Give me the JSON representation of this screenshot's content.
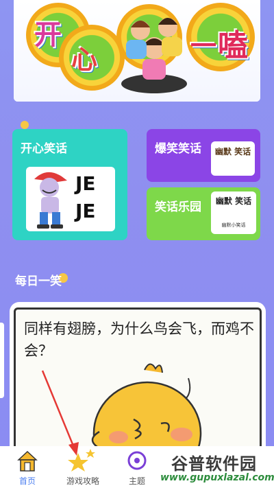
{
  "banner": {
    "title_chars": [
      "开",
      "心",
      "一",
      "嗑"
    ],
    "caption_left": "",
    "caption_right": ""
  },
  "cards": {
    "happy": {
      "title": "开心笑话",
      "img_text1": "JE",
      "img_text2": "JE",
      "color": "#2ed3c4"
    },
    "burst": {
      "title": "爆笑笑话",
      "img_text": "幽默 笑话",
      "color": "#8b45e6"
    },
    "paradise": {
      "title": "笑话乐园",
      "img_text": "幽默 笑话",
      "img_sub": "幽默小笑话",
      "color": "#7ed84a"
    }
  },
  "daily": {
    "section_title": "每日一笑",
    "joke": "同样有翅膀，为什么鸟会飞，而鸡不会？"
  },
  "tabbar": {
    "tabs": [
      {
        "label": "首页",
        "active": true
      },
      {
        "label": "游戏攻略",
        "active": false
      },
      {
        "label": "主题",
        "active": false
      }
    ]
  },
  "watermark": {
    "title": "谷普软件园",
    "url": "www.gupuxlazal.com"
  },
  "colors": {
    "background": "#8e95f2",
    "accent": "#4a7ef0",
    "annotation_arrow": "#e53935"
  }
}
